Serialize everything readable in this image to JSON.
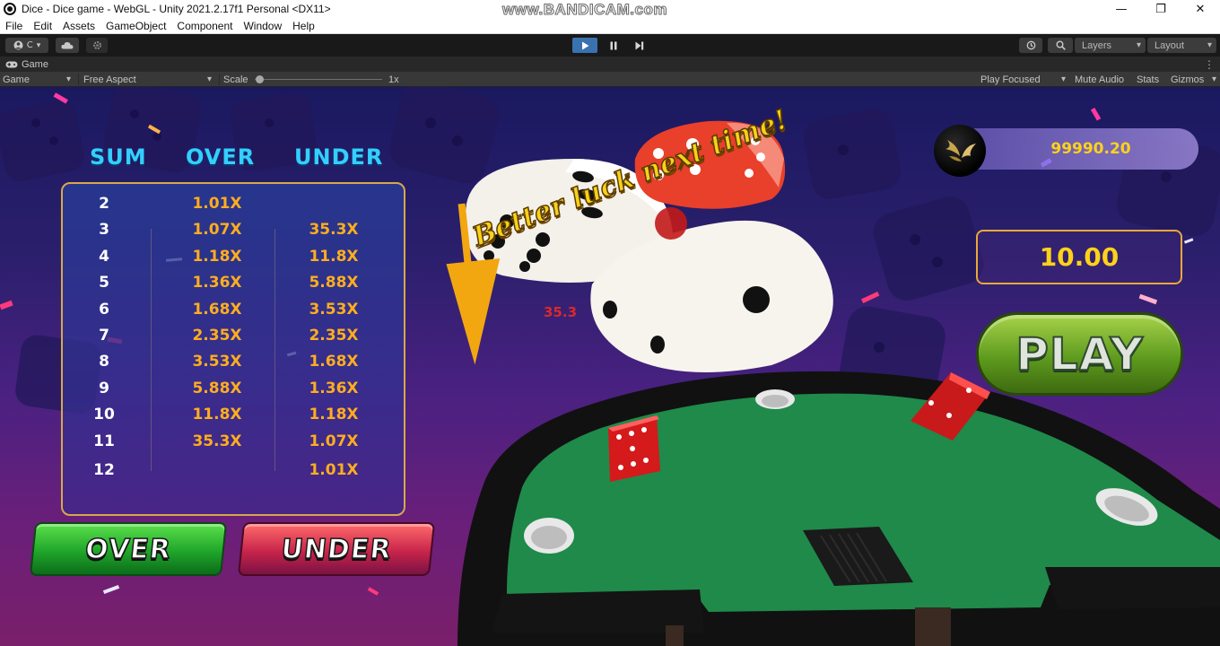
{
  "window": {
    "title": "Dice - Dice game - WebGL - Unity 2021.2.17f1 Personal <DX11>",
    "watermark": "www.BANDICAM.com",
    "minimize_glyph": "—",
    "restore_glyph": "❐",
    "close_glyph": "✕"
  },
  "menu": [
    "File",
    "Edit",
    "Assets",
    "GameObject",
    "Component",
    "Window",
    "Help"
  ],
  "toolbar": {
    "account_label": "C",
    "layers_label": "Layers",
    "layout_label": "Layout",
    "play_state": "playing"
  },
  "game_tab": {
    "label": "Game"
  },
  "game_toolbar": {
    "display": "Game",
    "aspect": "Free Aspect",
    "scale_label": "Scale",
    "scale_value": "1x",
    "play_mode": "Play Focused",
    "mute": "Mute Audio",
    "stats": "Stats",
    "gizmos": "Gizmos"
  },
  "table": {
    "headers": {
      "sum": "SUM",
      "over": "OVER",
      "under": "UNDER"
    },
    "rows": [
      {
        "sum": "2",
        "over": "1.01X",
        "under": ""
      },
      {
        "sum": "3",
        "over": "1.07X",
        "under": "35.3X"
      },
      {
        "sum": "4",
        "over": "1.18X",
        "under": "11.8X"
      },
      {
        "sum": "5",
        "over": "1.36X",
        "under": "5.88X"
      },
      {
        "sum": "6",
        "over": "1.68X",
        "under": "3.53X"
      },
      {
        "sum": "7",
        "over": "2.35X",
        "under": "2.35X"
      },
      {
        "sum": "8",
        "over": "3.53X",
        "under": "1.68X"
      },
      {
        "sum": "9",
        "over": "5.88X",
        "under": "1.36X"
      },
      {
        "sum": "10",
        "over": "11.8X",
        "under": "1.18X"
      },
      {
        "sum": "11",
        "over": "35.3X",
        "under": "1.07X"
      },
      {
        "sum": "12",
        "over": "",
        "under": "1.01X"
      }
    ]
  },
  "buttons": {
    "over": "OVER",
    "under": "UNDER",
    "play": "PLAY"
  },
  "balance": "99990.20",
  "bet": "10.00",
  "result_message": "Better luck next time!",
  "partial_value": "35.3",
  "colors": {
    "header_blue": "#33cfff",
    "multiplier_orange": "#ffad1f",
    "gold": "#ffd21a",
    "felt_green": "#1f8a4a"
  }
}
